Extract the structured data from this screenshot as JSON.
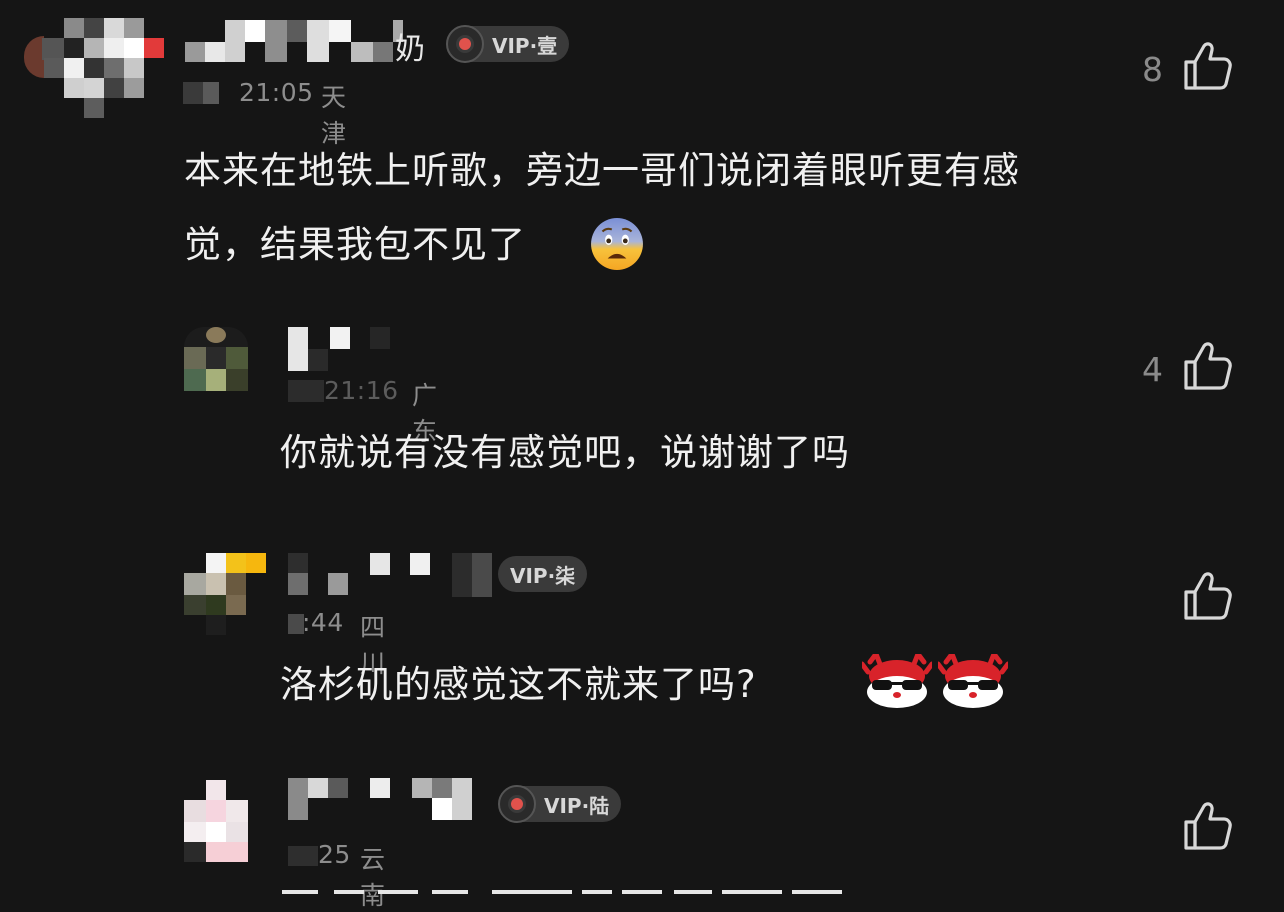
{
  "comments": [
    {
      "meta_time": "21:05",
      "meta_location": "天津",
      "name_tail": "奶",
      "vip_label": "VIP·壹",
      "text_line1": "本来在地铁上听歌，旁边一哥们说闭着眼听更有感",
      "text_line2": "觉，结果我包不见了",
      "emoji": "fearful-face-emoji",
      "likes": "8"
    }
  ],
  "replies": [
    {
      "meta_time": "21:16",
      "meta_location": "广东",
      "text": "你就说有没有感觉吧，说谢谢了吗",
      "likes": "4"
    },
    {
      "meta_time": ":44",
      "meta_location": "四川",
      "vip_label": "VIP·柒",
      "text": "洛杉矶的感觉这不就来了吗?",
      "emoji": "cool-crab-sticker",
      "likes": ""
    },
    {
      "meta_time": "25",
      "meta_location": "云南",
      "vip_label": "VIP·陆",
      "text": "",
      "likes": ""
    }
  ],
  "colors": {
    "background": "#151515",
    "text": "#f0f0f0",
    "meta": "#8d8d8d",
    "vip_dot": "#e0524c"
  }
}
